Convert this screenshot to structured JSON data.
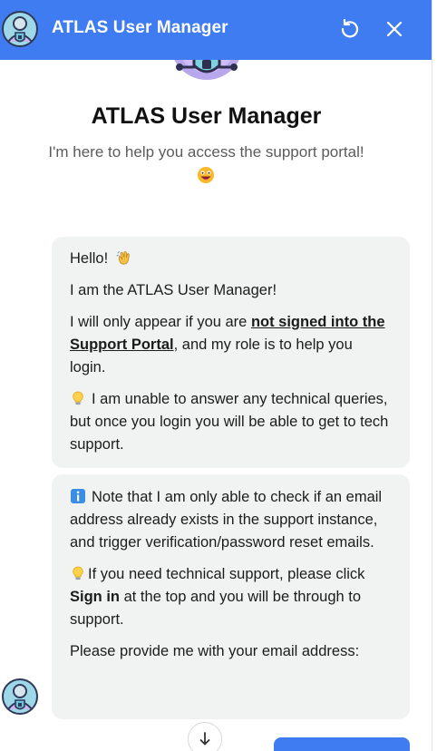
{
  "header": {
    "title": "ATLAS User Manager",
    "avatar_icon": "security-bot-avatar-icon",
    "refresh_icon": "refresh-icon",
    "close_icon": "close-icon",
    "color": "#3f7cf2"
  },
  "hero": {
    "logo_icon": "shield-bot-logo-icon",
    "title": "ATLAS User Manager",
    "subtitle": "I'm here to help you access the support portal!",
    "emoji_icon": "grinning-face-icon"
  },
  "messages": [
    {
      "greeting": "Hello!",
      "greeting_emoji": "waving-hand-icon",
      "intro": "I am the ATLAS User Manager!",
      "role_pre": "I will only appear if you are ",
      "role_link": "not signed into the Support Portal",
      "role_post": ", and my role is to help you login.",
      "tip_icon": "light-bulb-icon",
      "tip": "I am unable to answer any technical queries, but once you login you will be able to get to tech support."
    },
    {
      "info_icon": "information-icon",
      "note": "Note that I am only able to check if an email address already exists in the support instance, and trigger verification/password reset emails.",
      "tip_icon": "light-bulb-icon",
      "tip_pre": "If you need technical support, please click ",
      "tip_bold": "Sign in",
      "tip_post": " at the top and you will be through to support.",
      "request": "Please provide me with your email address:"
    }
  ],
  "bot_avatar_icon": "security-bot-avatar-icon",
  "scroll_down_icon": "arrow-down-icon"
}
